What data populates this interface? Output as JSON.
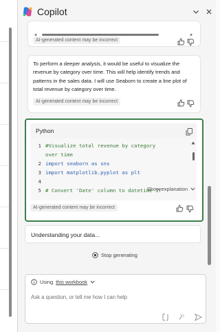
{
  "header": {
    "title": "Copilot",
    "icons": [
      "copilot-logo-icon",
      "chevron-down-icon",
      "close-icon"
    ]
  },
  "messages": [
    {
      "ai_disclaimer": "AI-generated content may be incorrect"
    },
    {
      "text": "To perform a deeper analysis, it would be useful to visualize the revenue by category over time. This will help identify trends and patterns in the sales data. I will use Seaborn to create a line plot of total revenue by category over time.",
      "ai_disclaimer": "AI-generated content may be incorrect"
    }
  ],
  "code_block": {
    "language": "Python",
    "lines": [
      {
        "num": "1",
        "text": "#Visualize total revenue by category",
        "kind": "comment"
      },
      {
        "num": "",
        "text": "over time",
        "kind": "comment"
      },
      {
        "num": "2",
        "text": "import seaborn as sns",
        "kind": "import"
      },
      {
        "num": "3",
        "text": "import matplotlib.pyplot as plt",
        "kind": "import"
      },
      {
        "num": "4",
        "text": "",
        "kind": "plain"
      },
      {
        "num": "5",
        "text": "# Convert 'Date' column to datetime if",
        "kind": "comment"
      }
    ],
    "show_explanation": "Show explanation",
    "ai_disclaimer": "AI-generated content may be incorrect"
  },
  "status": {
    "text": "Understanding your data..."
  },
  "stop_button": "Stop generating",
  "input": {
    "context_prefix": "Using",
    "context_link": "this workbook",
    "placeholder": "Ask a question, or tell me how I can help"
  },
  "colors": {
    "focus_border": "#3b7f49",
    "comment": "#3a7a3a",
    "keyword": "#2d5fb0"
  }
}
